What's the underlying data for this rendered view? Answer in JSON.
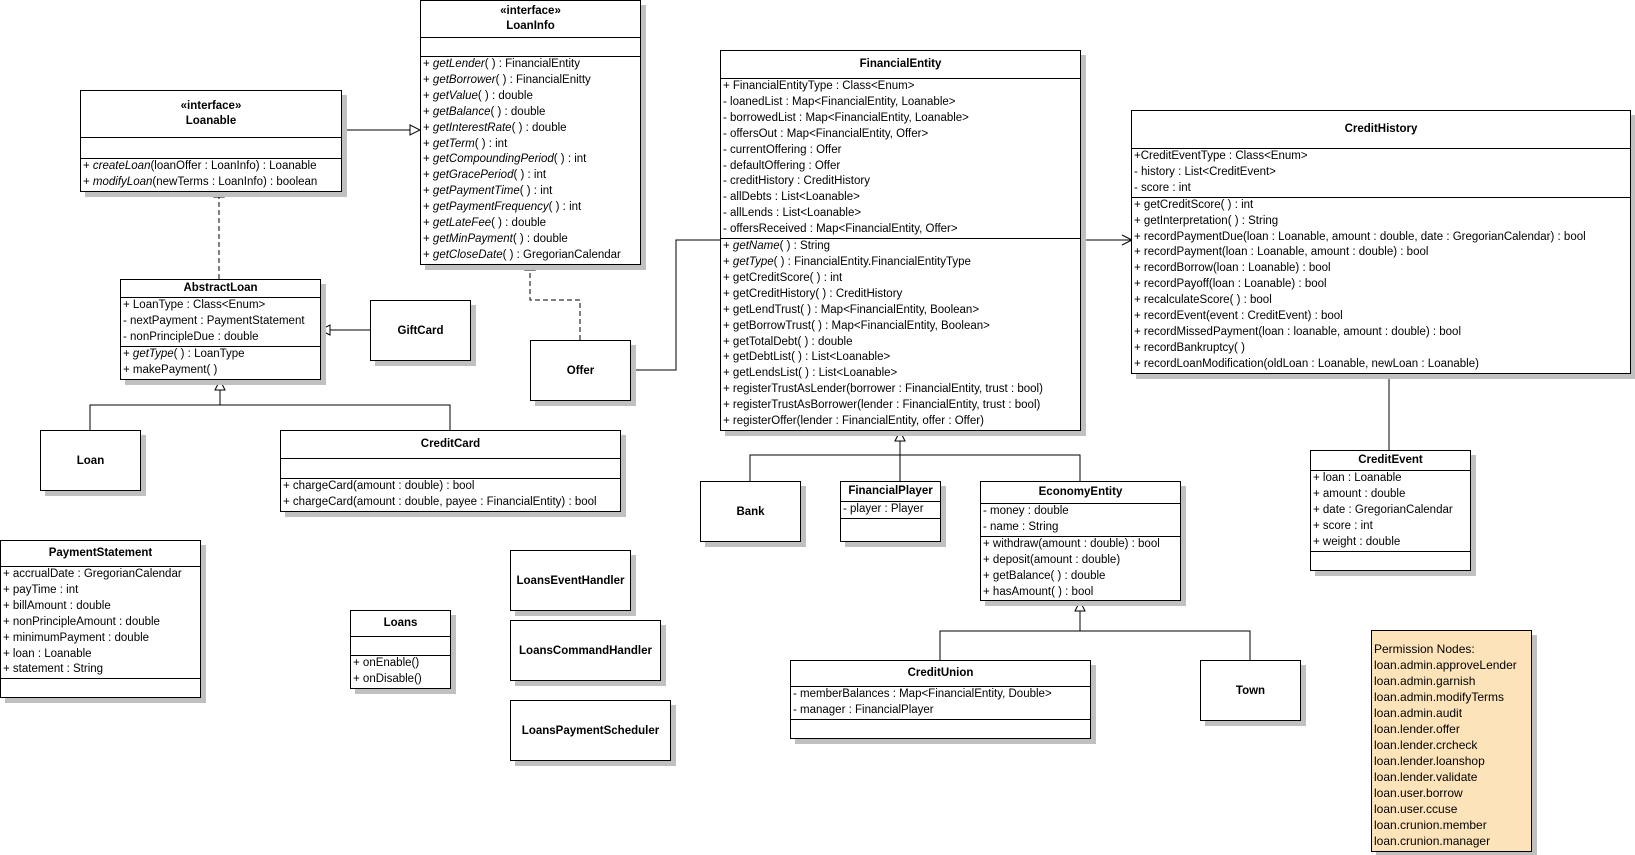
{
  "classes": {
    "loaninfo": {
      "stereotype": "«interface»",
      "name": "LoanInfo",
      "ops": [
        {
          "vis": "+ ",
          "name": "getLender",
          "rest": "( ) : FinancialEntity",
          "italic": true
        },
        {
          "vis": "+ ",
          "name": "getBorrower",
          "rest": "( ) : FinancialEnitty",
          "italic": true
        },
        {
          "vis": "+ ",
          "name": "getValue",
          "rest": "( ) : double",
          "italic": true
        },
        {
          "vis": "+ ",
          "name": "getBalance",
          "rest": "( ) : double",
          "italic": true
        },
        {
          "vis": "+ ",
          "name": "getInterestRate",
          "rest": "( ) : double",
          "italic": true
        },
        {
          "vis": "+ ",
          "name": "getTerm",
          "rest": "( ) : int",
          "italic": true
        },
        {
          "vis": "+ ",
          "name": "getCompoundingPeriod",
          "rest": "( ) : int",
          "italic": true
        },
        {
          "vis": "+ ",
          "name": "getGracePeriod",
          "rest": "( ) : int",
          "italic": true
        },
        {
          "vis": "+ ",
          "name": "getPaymentTime",
          "rest": "( ) : int",
          "italic": true
        },
        {
          "vis": "+ ",
          "name": "getPaymentFrequency",
          "rest": "( ) : int",
          "italic": true
        },
        {
          "vis": "+ ",
          "name": "getLateFee",
          "rest": "( ) : double",
          "italic": true
        },
        {
          "vis": "+ ",
          "name": "getMinPayment",
          "rest": "( ) : double",
          "italic": true
        },
        {
          "vis": "+ ",
          "name": "getCloseDate",
          "rest": "( ) : GregorianCalendar",
          "italic": true
        }
      ]
    },
    "loanable": {
      "stereotype": "«interface»",
      "name": "Loanable",
      "ops": [
        {
          "vis": "+ ",
          "name": "createLoan",
          "rest": "(loanOffer : LoanInfo) : Loanable",
          "italic": true
        },
        {
          "vis": "+ ",
          "name": "modifyLoan",
          "rest": "(newTerms : LoanInfo) : boolean",
          "italic": true
        }
      ]
    },
    "abstractloan": {
      "name": "AbstractLoan",
      "attrs": [
        "+ LoanType : Class<Enum>",
        "- nextPayment : PaymentStatement",
        "- nonPrincipleDue : double"
      ],
      "ops": [
        {
          "vis": "+ ",
          "name": "getType",
          "rest": "( ) : LoanType",
          "italic": true
        },
        {
          "vis": "+ ",
          "name": "makePayment",
          "rest": "( )",
          "italic": false
        }
      ]
    },
    "giftcard": {
      "name": "GiftCard"
    },
    "loan": {
      "name": "Loan"
    },
    "creditcard": {
      "name": "CreditCard",
      "ops": [
        {
          "vis": "+ ",
          "name": "chargeCard",
          "rest": "(amount : double) : bool",
          "italic": false
        },
        {
          "vis": "+ ",
          "name": "chargeCard",
          "rest": "(amount : double, payee : FinancialEntity) : bool",
          "italic": false
        }
      ]
    },
    "offer": {
      "name": "Offer"
    },
    "paymentstatement": {
      "name": "PaymentStatement",
      "attrs": [
        "+ accrualDate : GregorianCalendar",
        "+ payTime : int",
        "+ billAmount : double",
        "+ nonPrincipleAmount : double",
        "+ minimumPayment : double",
        "+ loan : Loanable",
        "+ statement : String"
      ]
    },
    "loans": {
      "name": "Loans",
      "ops": [
        {
          "vis": "+ ",
          "name": "onEnable",
          "rest": "()",
          "italic": false
        },
        {
          "vis": "+ ",
          "name": "onDisable",
          "rest": "()",
          "italic": false
        }
      ]
    },
    "loanseventhandler": {
      "name": "LoansEventHandler"
    },
    "loanscommandhandler": {
      "name": "LoansCommandHandler"
    },
    "loanspaymentscheduler": {
      "name": "LoansPaymentScheduler"
    },
    "financialentity": {
      "name": "FinancialEntity",
      "attrs": [
        "+ FinancialEntityType : Class<Enum>",
        "- loanedList : Map<FinancialEntity, Loanable>",
        "- borrowedList : Map<FinancialEntity, Loanable>",
        "- offersOut : Map<FinancialEntity, Offer>",
        "- currentOffering : Offer",
        "- defaultOffering : Offer",
        "- creditHistory : CreditHistory",
        "- allDebts : List<Loanable>",
        "- allLends : List<Loanable>",
        "- offersReceived : Map<FinancialEntity, Offer>"
      ],
      "ops": [
        {
          "vis": "+ ",
          "name": "getName",
          "rest": "( ) : String",
          "italic": true
        },
        {
          "vis": "+ ",
          "name": "getType",
          "rest": "( ) : FinancialEntity.FinancialEntityType",
          "italic": true
        },
        {
          "vis": "+ ",
          "name": "getCreditScore",
          "rest": "( ) : int",
          "italic": false
        },
        {
          "vis": "+ ",
          "name": "getCreditHistory",
          "rest": "( ) : CreditHistory",
          "italic": false
        },
        {
          "vis": "+ ",
          "name": "getLendTrust",
          "rest": "( ) : Map<FinancialEntity, Boolean>",
          "italic": false
        },
        {
          "vis": "+ ",
          "name": "getBorrowTrust",
          "rest": "( ) : Map<FinancialEntity, Boolean>",
          "italic": false
        },
        {
          "vis": "+ ",
          "name": "getTotalDebt",
          "rest": "( ) : double",
          "italic": false
        },
        {
          "vis": "+ ",
          "name": "getDebtList",
          "rest": "( ) : List<Loanable>",
          "italic": false
        },
        {
          "vis": "+ ",
          "name": "getLendsList",
          "rest": "( ) : List<Loanable>",
          "italic": false
        },
        {
          "vis": "+ ",
          "name": "registerTrustAsLender",
          "rest": "(borrower : FinancialEntity, trust : bool)",
          "italic": false
        },
        {
          "vis": "+ ",
          "name": "registerTrustAsBorrower",
          "rest": "(lender : FinancialEntity, trust : bool)",
          "italic": false
        },
        {
          "vis": "+ ",
          "name": "registerOffer",
          "rest": "(lender : FinancialEntity, offer : Offer)",
          "italic": false
        }
      ]
    },
    "bank": {
      "name": "Bank"
    },
    "financialplayer": {
      "name": "FinancialPlayer",
      "attrs": [
        "- player : Player"
      ]
    },
    "economyentity": {
      "name": "EconomyEntity",
      "attrs": [
        "- money : double",
        "- name : String"
      ],
      "ops": [
        {
          "vis": "+ ",
          "name": "withdraw",
          "rest": "(amount : double) : bool",
          "italic": false
        },
        {
          "vis": "+ ",
          "name": "deposit",
          "rest": "(amount : double)",
          "italic": false
        },
        {
          "vis": "+ ",
          "name": "getBalance",
          "rest": "( ) : double",
          "italic": false
        },
        {
          "vis": "+ ",
          "name": "hasAmount",
          "rest": "( ) : bool",
          "italic": false
        }
      ]
    },
    "creditunion": {
      "name": "CreditUnion",
      "attrs": [
        "- memberBalances : Map<FinancialEntity, Double>",
        "- manager : FinancialPlayer"
      ]
    },
    "town": {
      "name": "Town"
    },
    "credithistory": {
      "name": "CreditHistory",
      "attrs": [
        "+CreditEventType : Class<Enum>",
        "- history : List<CreditEvent>",
        "- score : int"
      ],
      "ops": [
        {
          "vis": "+ ",
          "name": "getCreditScore",
          "rest": "( ) : int",
          "italic": false
        },
        {
          "vis": "+ ",
          "name": "getInterpretation",
          "rest": "( ) : String",
          "italic": false
        },
        {
          "vis": "+ ",
          "name": "recordPaymentDue",
          "rest": "(loan : Loanable, amount : double, date : GregorianCalendar) : bool",
          "italic": false
        },
        {
          "vis": "+ ",
          "name": "recordPayment",
          "rest": "(loan : Loanable, amount : double) : bool",
          "italic": false
        },
        {
          "vis": "+ ",
          "name": "recordBorrow",
          "rest": "(loan : Loanable) : bool",
          "italic": false
        },
        {
          "vis": "+ ",
          "name": "recordPayoff",
          "rest": "(loan : Loanable) : bool",
          "italic": false
        },
        {
          "vis": "+ ",
          "name": "recalculateScore",
          "rest": "( ) : bool",
          "italic": false
        },
        {
          "vis": "+ ",
          "name": "recordEvent",
          "rest": "(event : CreditEvent) : bool",
          "italic": false
        },
        {
          "vis": "+ ",
          "name": "recordMissedPayment",
          "rest": "(loan : loanable, amount : double) : bool",
          "italic": false
        },
        {
          "vis": "+ ",
          "name": "recordBankruptcy",
          "rest": "( )",
          "italic": false
        },
        {
          "vis": "+ ",
          "name": "recordLoanModification",
          "rest": "(oldLoan : Loanable, newLoan : Loanable)",
          "italic": false
        }
      ]
    },
    "creditevent": {
      "name": "CreditEvent",
      "attrs": [
        "+ loan : Loanable",
        "+ amount : double",
        "+ date : GregorianCalendar",
        "+ score : int",
        "+ weight : double"
      ]
    }
  },
  "note": {
    "title": "Permission Nodes:",
    "lines": [
      "loan.admin.approveLender",
      "loan.admin.garnish",
      "loan.admin.modifyTerms",
      "loan.admin.audit",
      "loan.lender.offer",
      "loan.lender.crcheck",
      "loan.lender.loanshop",
      "loan.lender.validate",
      "loan.user.borrow",
      "loan.user.ccuse",
      "loan.crunion.member",
      "loan.crunion.manager"
    ],
    "color": "#fde3b9"
  }
}
